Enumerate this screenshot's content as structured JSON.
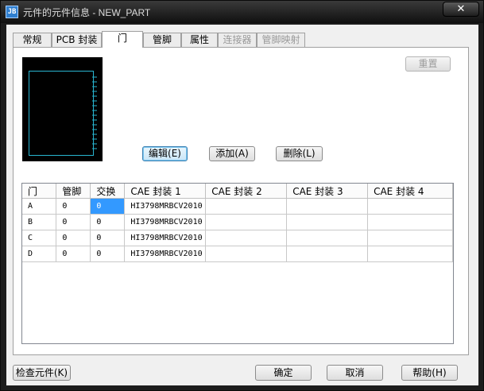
{
  "titlebar": {
    "icon_text": "JB",
    "title": "元件的元件信息 - NEW_PART",
    "close_glyph": "✕"
  },
  "tabs": [
    {
      "label": "常规",
      "state": "normal"
    },
    {
      "label": "PCB 封装",
      "state": "normal"
    },
    {
      "label": "门",
      "state": "active"
    },
    {
      "label": "管脚",
      "state": "normal"
    },
    {
      "label": "属性",
      "state": "normal"
    },
    {
      "label": "连接器",
      "state": "disabled"
    },
    {
      "label": "管脚映射",
      "state": "disabled"
    }
  ],
  "gate_panel": {
    "reset_label": "重置",
    "edit_label": "编辑(E)",
    "add_label": "添加(A)",
    "delete_label": "删除(L)"
  },
  "gate_table": {
    "columns": [
      "门",
      "管脚",
      "交换",
      "CAE 封装 1",
      "CAE 封装 2",
      "CAE 封装 3",
      "CAE 封装 4"
    ],
    "rows": [
      [
        "A",
        "0",
        "0",
        "HI3798MRBCV2010",
        "",
        "",
        ""
      ],
      [
        "B",
        "0",
        "0",
        "HI3798MRBCV2010",
        "",
        "",
        ""
      ],
      [
        "C",
        "0",
        "0",
        "HI3798MRBCV2010",
        "",
        "",
        ""
      ],
      [
        "D",
        "0",
        "0",
        "HI3798MRBCV2010",
        "",
        "",
        ""
      ]
    ]
  },
  "footer": {
    "check_label": "检查元件(K)",
    "ok_label": "确定",
    "cancel_label": "取消",
    "help_label": "帮助(H)"
  },
  "colors": {
    "preview_bg": "#000000",
    "preview_outline": "#29b6d1",
    "selection": "#3399ff"
  }
}
